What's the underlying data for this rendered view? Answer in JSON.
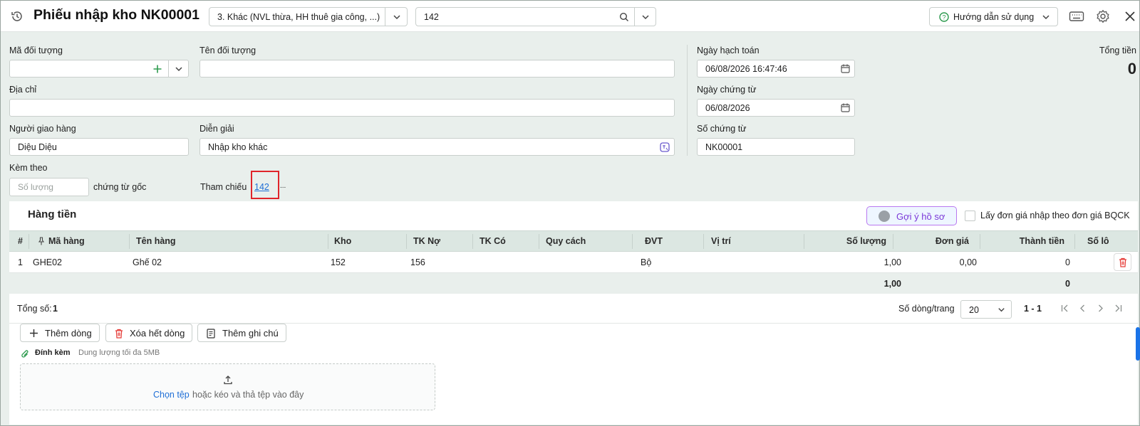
{
  "header": {
    "title": "Phiếu nhập kho NK00001",
    "type_select": "3. Khác (NVL thừa, HH thuê gia công, ...)",
    "search_value": "142",
    "help_label": "Hướng dẫn sử dụng"
  },
  "form": {
    "ma_doi_tuong_label": "Mã đối tượng",
    "ten_doi_tuong_label": "Tên đối tượng",
    "dia_chi_label": "Địa chỉ",
    "nguoi_giao_hang_label": "Người giao hàng",
    "nguoi_giao_hang_value": "Diệu Diệu",
    "dien_giai_label": "Diễn giải",
    "dien_giai_value": "Nhập kho khác",
    "kem_theo_label": "Kèm theo",
    "so_luong_placeholder": "Số lượng",
    "chung_tu_goc_label": "chứng từ gốc",
    "tham_chieu_label": "Tham chiếu",
    "tham_chieu_link": "142",
    "tham_chieu_more": "...",
    "ngay_hach_toan_label": "Ngày hạch toán",
    "ngay_hach_toan_value": "06/08/2026 16:47:46",
    "ngay_chung_tu_label": "Ngày chứng từ",
    "ngay_chung_tu_value": "06/08/2026",
    "so_chung_tu_label": "Số chứng từ",
    "so_chung_tu_value": "NK00001",
    "tong_tien_label": "Tổng tiền",
    "tong_tien_value": "0"
  },
  "grid": {
    "section_title": "Hàng tiền",
    "suggest_label": "Gợi ý hồ sơ",
    "checkbox_label": "Lấy đơn giá nhập theo đơn giá BQCK",
    "columns": [
      "#",
      "Mã hàng",
      "Tên hàng",
      "Kho",
      "TK Nợ",
      "TK Có",
      "Quy cách",
      "ĐVT",
      "Vị trí",
      "Số lượng",
      "Đơn giá",
      "Thành tiền",
      "Số lô"
    ],
    "rows": [
      {
        "stt": "1",
        "ma_hang": "GHE02",
        "ten_hang": "Ghế 02",
        "kho": "152",
        "tk_no": "156",
        "tk_co": "",
        "quy_cach": "",
        "dvt": "Bộ",
        "vi_tri": "",
        "so_luong": "1,00",
        "don_gia": "0,00",
        "thanh_tien": "0",
        "so_lo": ""
      }
    ],
    "sum_so_luong": "1,00",
    "sum_thanh_tien": "0"
  },
  "pager": {
    "total_label": "Tổng số:",
    "total_value": "1",
    "rows_per_page_label": "Số dòng/trang",
    "rows_per_page_value": "20",
    "range": "1 - 1"
  },
  "actions": {
    "add_row": "Thêm dòng",
    "delete_all": "Xóa hết dòng",
    "add_note": "Thêm ghi chú"
  },
  "attach": {
    "label": "Đính kèm",
    "hint": "Dung lượng tối đa 5MB",
    "choose_file": "Chọn tệp",
    "drop_text": "hoặc kéo và thả tệp vào đây"
  },
  "colors": {
    "accent": "#1f6fd6",
    "highlight_border": "#e0242a",
    "header_row": "#dce7e2",
    "danger": "#e53935",
    "suggest": "#7b38d8"
  }
}
